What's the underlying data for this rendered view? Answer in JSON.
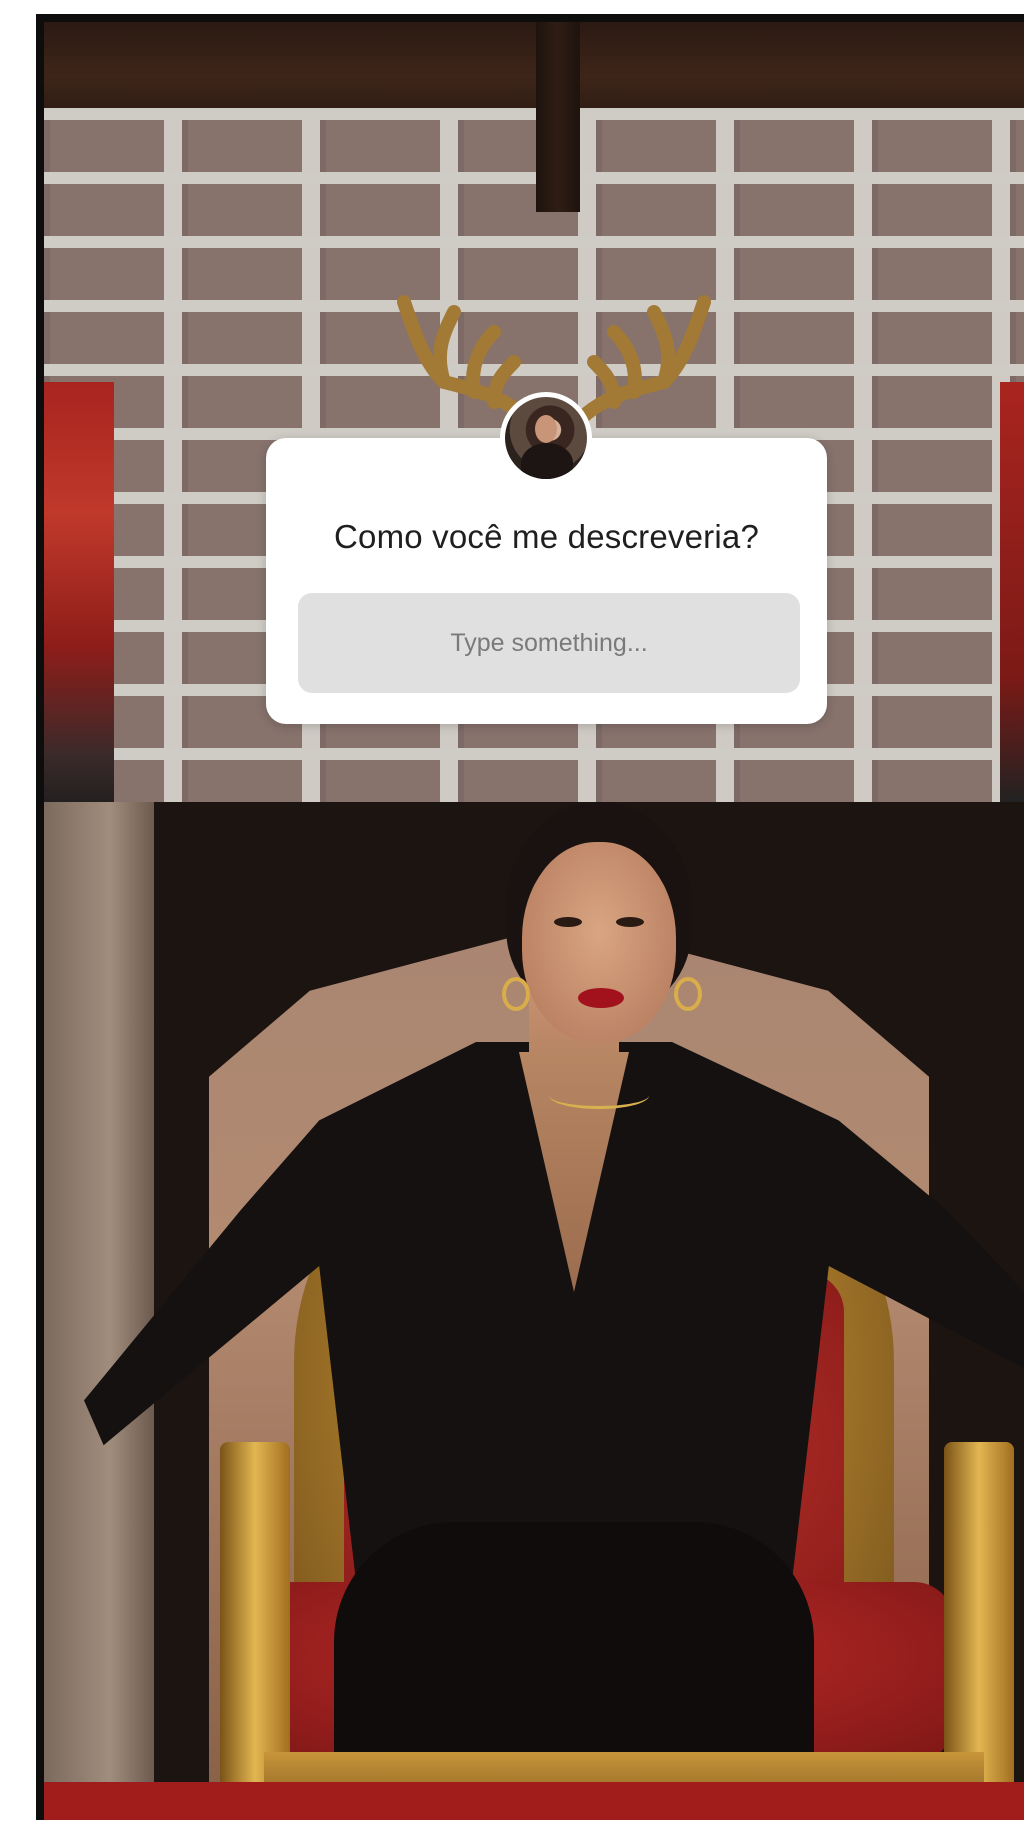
{
  "story": {
    "question_sticker": {
      "question": "Como você me descreveria?",
      "input_placeholder": "Type something..."
    }
  },
  "colors": {
    "sticker_bg": "#ffffff",
    "input_bg": "#e0e0e0",
    "lipstick": "#a1121c",
    "chair_gold": "#d8b04a",
    "chair_red": "#c2342e"
  }
}
